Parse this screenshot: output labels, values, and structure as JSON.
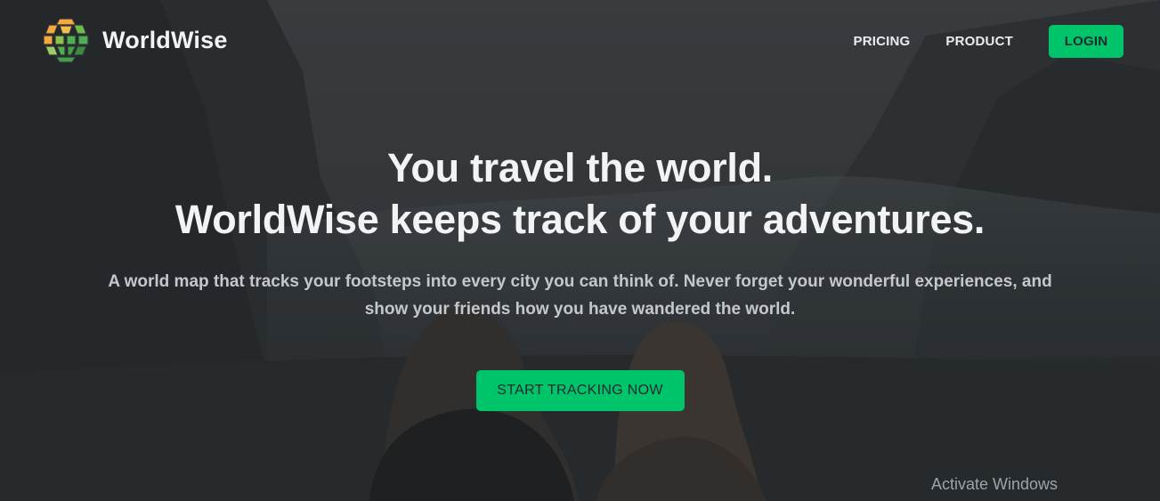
{
  "brand": {
    "name": "WorldWise",
    "logo_icon": "globe-hex-logo-icon"
  },
  "nav": {
    "links": [
      {
        "label": "PRICING"
      },
      {
        "label": "PRODUCT"
      }
    ],
    "login_label": "LOGIN"
  },
  "hero": {
    "headline_line1": "You travel the world.",
    "headline_line2": "WorldWise keeps track of your adventures.",
    "subtext": "A world map that tracks your footsteps into every city you can think of. Never forget your wonderful experiences, and show your friends how you have wandered the world.",
    "cta_label": "START TRACKING NOW"
  },
  "watermark": {
    "text": "Activate Windows"
  },
  "colors": {
    "accent": "#00c46a",
    "logo_orange": "#f4a93a",
    "logo_green": "#4caf50",
    "text_light": "#f1f3f5",
    "background_dark": "#2f3236"
  }
}
